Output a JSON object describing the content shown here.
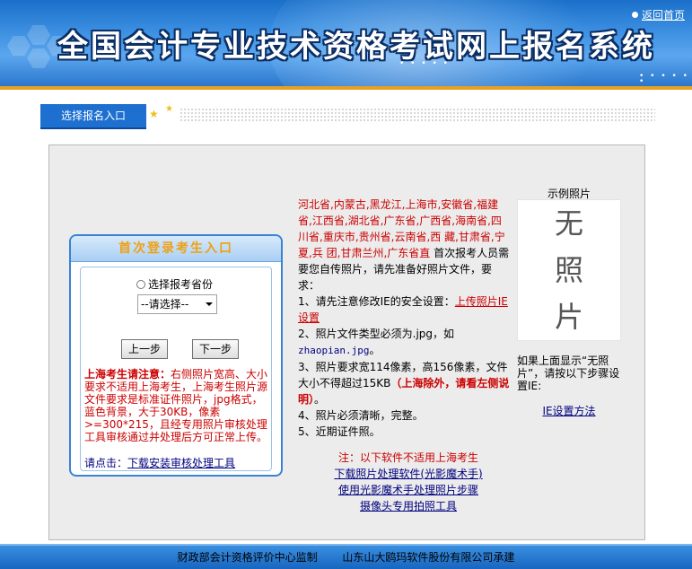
{
  "header": {
    "title": "全国会计专业技术资格考试网上报名系统",
    "home_link": "返回首页"
  },
  "tab": {
    "label": "选择报名入口"
  },
  "login": {
    "title": "首次登录考生入口",
    "radio_label": "选择报考省份",
    "select_value": "--请选择--",
    "prev_button": "上一步",
    "next_button": "下一步",
    "shanghai_heading": "上海考生请注意：",
    "shanghai_note": "右侧照片宽高、大小要求不适用上海考生，上海考生照片源文件要求是标准证件照片，jpg格式，蓝色背景，大于30KB，像素>=300*215，且经专用照片审核处理工具审核通过并处理后方可正常上传。",
    "download_prefix": "请点击：",
    "download_link": "下载安装审核处理工具"
  },
  "instructions": {
    "provinces": "河北省,内蒙古,黑龙江,上海市,安徽省,福建省,江西省,湖北省,广东省,广西省,海南省,四川省,重庆市,贵州省,云南省,西 藏,甘肃省,宁 夏,兵 团,甘肃兰州,广东省直",
    "intro": " 首次报考人员需要您自传照片，请先准备好照片文件，要求：",
    "item1_prefix": "1、请先注意修改IE的安全设置：",
    "item1_link": "上传照片IE设置",
    "item2_prefix": "2、照片文件类型必须为.jpg，如",
    "item2_example": "zhaopian.jpg",
    "item2_suffix": "。",
    "item3_prefix": "3、照片要求宽114像素，高156像素，文件大小不得超过15KB",
    "item3_highlight": "（上海除外，请看左侧说明）",
    "item3_suffix": "。",
    "item4": "4、照片必须清晰，完整。",
    "item5": "5、近期证件照。"
  },
  "links": {
    "note": "注：以下软件不适用上海考生",
    "link1": "下载照片处理软件(光影魔术手)",
    "link2": "使用光影魔术手处理照片步骤",
    "link3": "摄像头专用拍照工具"
  },
  "sample": {
    "label": "示例照片",
    "char1": "无",
    "char2": "照",
    "char3": "片",
    "hint": "如果上面显示“无照片”，请按以下步骤设置IE:",
    "ie_link": "IE设置方法"
  },
  "footer": {
    "left": "财政部会计资格评价中心监制",
    "right": "山东山大鸥玛软件股份有限公司承建"
  },
  "colors": {
    "header_blue": "#2a7fd8",
    "accent_orange": "#e8a020",
    "link_blue": "#00007f",
    "warning_red": "#cc0000"
  }
}
